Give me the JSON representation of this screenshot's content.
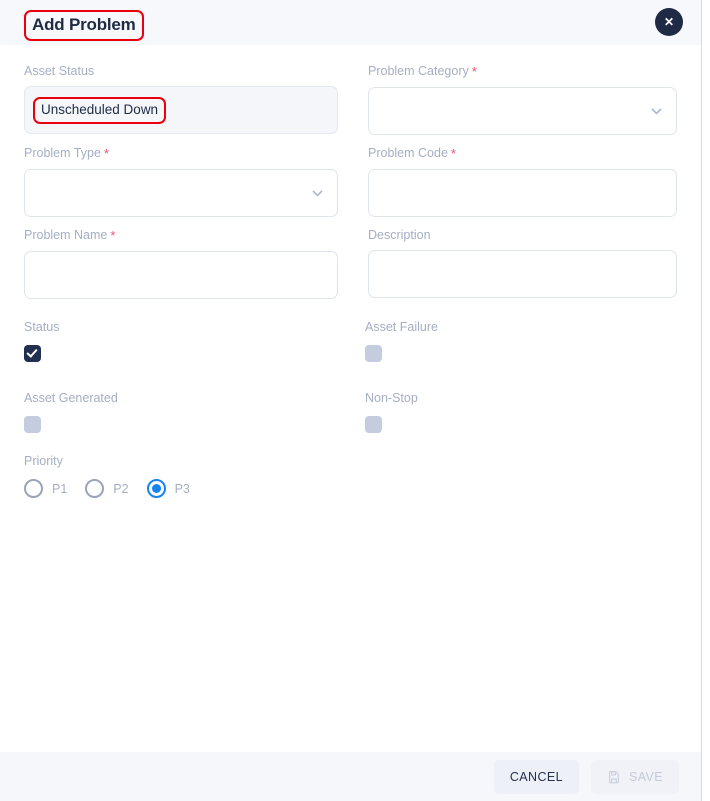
{
  "header": {
    "title": "Add Problem",
    "close_label": "✕",
    "close_icon": "close-icon"
  },
  "form": {
    "fields": [
      {
        "key": "asset_status",
        "label": "Asset Status",
        "required": false,
        "type": "readonly-text",
        "value": "Unscheduled Down",
        "placeholder": ""
      },
      {
        "key": "problem_category",
        "label": "Problem Category",
        "required": true,
        "type": "select",
        "value": "",
        "placeholder": "",
        "icon": "chevron-down-icon"
      },
      {
        "key": "problem_type",
        "label": "Problem Type",
        "required": true,
        "type": "select",
        "value": "",
        "placeholder": "",
        "icon": "chevron-down-icon"
      },
      {
        "key": "problem_code",
        "label": "Problem Code",
        "required": true,
        "type": "text",
        "value": "",
        "placeholder": ""
      },
      {
        "key": "problem_name",
        "label": "Problem Name",
        "required": true,
        "type": "text",
        "value": "",
        "placeholder": ""
      },
      {
        "key": "description",
        "label": "Description",
        "required": false,
        "type": "text",
        "value": "",
        "placeholder": ""
      }
    ],
    "toggles": [
      {
        "key": "status",
        "label": "Status",
        "checked": true
      },
      {
        "key": "asset_failure",
        "label": "Asset Failure",
        "checked": false
      },
      {
        "key": "asset_generated",
        "label": "Asset Generated",
        "checked": false
      },
      {
        "key": "non_stop",
        "label": "Non-Stop",
        "checked": false
      }
    ],
    "priority": {
      "label": "Priority",
      "options": [
        {
          "value": "P1",
          "label": "P1",
          "selected": false
        },
        {
          "value": "P2",
          "label": "P2",
          "selected": false
        },
        {
          "value": "P3",
          "label": "P3",
          "selected": true
        }
      ]
    }
  },
  "footer": {
    "cancel_label": "CANCEL",
    "save_label": "SAVE",
    "save_icon": "save-document-icon",
    "save_disabled": true
  },
  "annotations": {
    "highlight_color": "#e8000d",
    "highlighted": [
      "Add Problem",
      "Unscheduled Down"
    ]
  },
  "colors": {
    "header_bg": "#f7f8fc",
    "footer_bg": "#f6f7fb",
    "body_bg": "#ffffff",
    "label": "#a6aec3",
    "text_dark": "#1f2a44",
    "required_asterisk": "#f0526d",
    "checkbox_on": "#22304f",
    "checkbox_off": "#c4cce0",
    "radio_selected": "#1683f5",
    "field_border": "#dfe3ec",
    "readonly_bg": "#f4f6fa"
  }
}
